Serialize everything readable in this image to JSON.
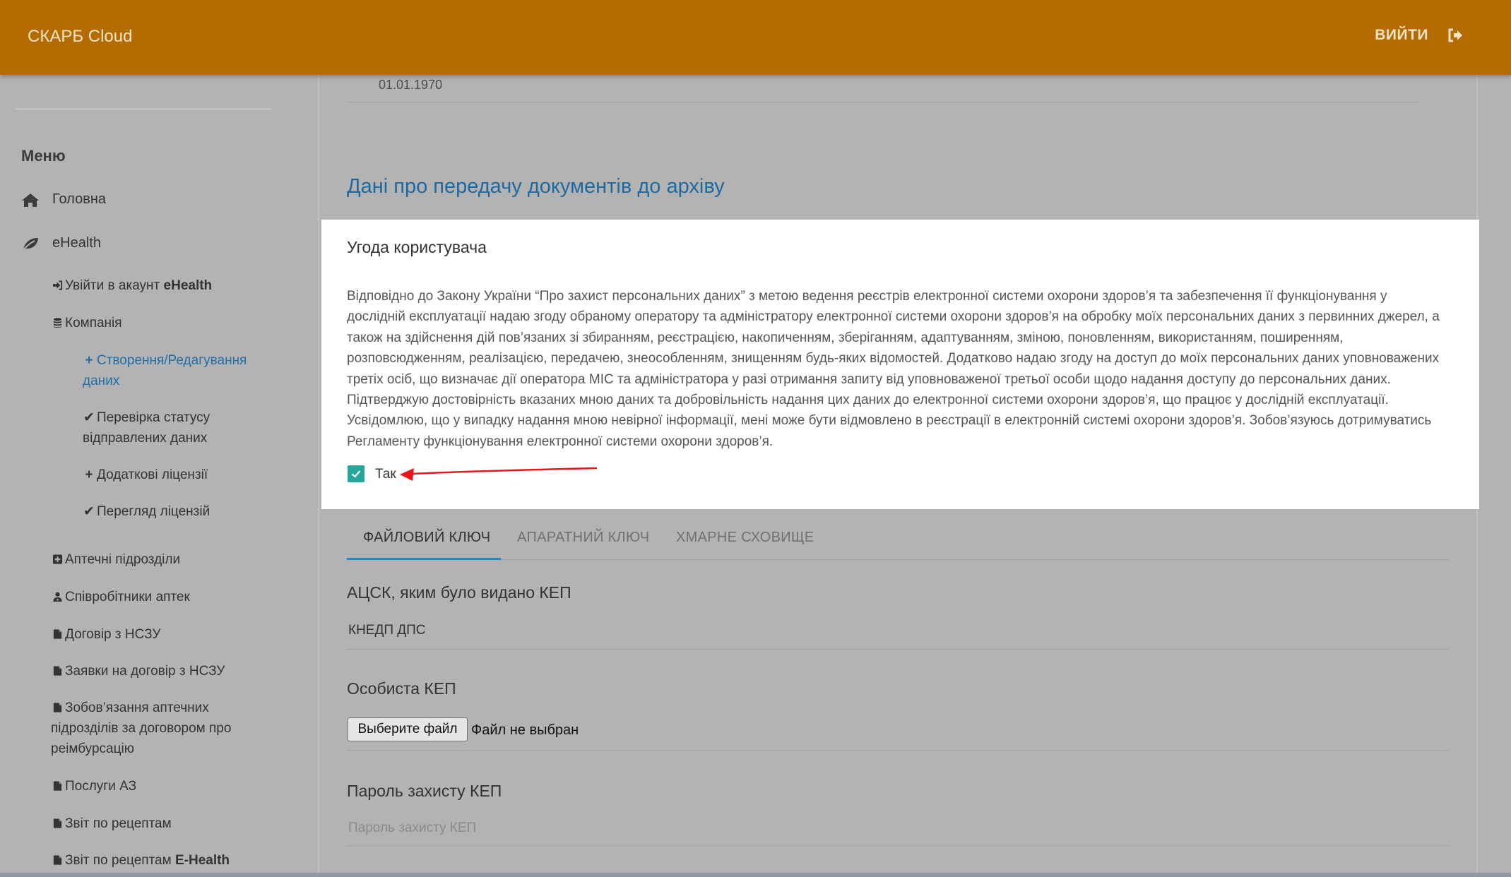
{
  "header": {
    "brand": "СКАРБ Cloud",
    "logout_label": "ВИЙТИ"
  },
  "sidebar": {
    "menu_title": "Меню",
    "home": "Головна",
    "ehealth": "eHealth",
    "login_prefix": "Увійти в акаунт ",
    "login_bold": "eHealth",
    "company": "Компанія",
    "create_edit": "Створення/Редагування даних",
    "check_status": "Перевірка статусу відправлених даних",
    "additional_licenses": "Додаткові ліцензії",
    "view_licenses": "Перегляд ліцензій",
    "pharmacy_units": "Аптечні підрозділи",
    "pharmacy_staff": "Співробітники аптек",
    "nszu_contract": "Договір з НСЗУ",
    "nszu_applications": "Заявки на договір з НСЗУ",
    "obligations": "Зобов’язання аптечних підрозділів за договором про реімбурсацію",
    "services": "Послуги АЗ",
    "recipe_report": "Звіт по рецептам",
    "recipe_report_eh_prefix": "Звіт по рецептам ",
    "recipe_report_eh_bold": "E-Health"
  },
  "main": {
    "date_value": "01.01.1970",
    "section_title": "Дані про передачу документів до архіву",
    "agreement": {
      "title": "Угода користувача",
      "text": "Відповідно до Закону України “Про захист персональних даних” з метою ведення реєстрів електронної системи охорони здоров’я та забезпечення її функціонування у дослідній експлуатації надаю згоду обраному оператору та адміністратору електронної системи охорони здоров’я на обробку моїх персональних даних з первинних джерел, а також на здійснення дій пов’язаних зі збиранням, реєстрацією, накопиченням, зберіганням, адаптуванням, зміною, поновленням, використанням, поширенням, розповсюдженням, реалізацією, передачею, знеособленням, знищенням будь-яких відомостей. Додатково надаю згоду на доступ до моїх персональних даних уповноважених третіх осіб, що визначає дії оператора МІС та адміністратора у разі отримання запиту від уповноваженої третьої особи щодо надання доступу до персональних даних. Підтверджую достовірність вказаних мною даних та добровільність надання цих даних до електронної системи охорони здоров’я, що працює у дослідній експлуатації. Усвідомлюю, що у випадку надання мною невірної інформації, мені може бути відмовлено в реєстрації в електронній системі охорони здоров’я. Зобов’язуюсь дотримуватись Регламенту функціонування електронної системи охорони здоров’я.",
      "checkbox_label": "Так",
      "checkbox_checked": true,
      "accent_color": "#26a69a",
      "arrow_color": "#e8151b"
    },
    "tabs": [
      "ФАЙЛОВИЙ КЛЮЧ",
      "АПАРАТНИЙ КЛЮЧ",
      "ХМАРНЕ СХОВИЩЕ"
    ],
    "active_tab": 0,
    "acsk": {
      "label": "АЦСК, яким було видано КЕП",
      "value": "КНЕДП ДПС"
    },
    "personal_key": {
      "label": "Особиста КЕП",
      "button": "Выберите файл",
      "status": "Файл не выбран"
    },
    "password": {
      "label": "Пароль захисту КЕП",
      "placeholder": "Пароль захисту КЕП"
    }
  },
  "colors": {
    "header_bg": "#b46c00",
    "link_blue": "#1e6aa0",
    "tab_underline": "#1e88c8"
  }
}
